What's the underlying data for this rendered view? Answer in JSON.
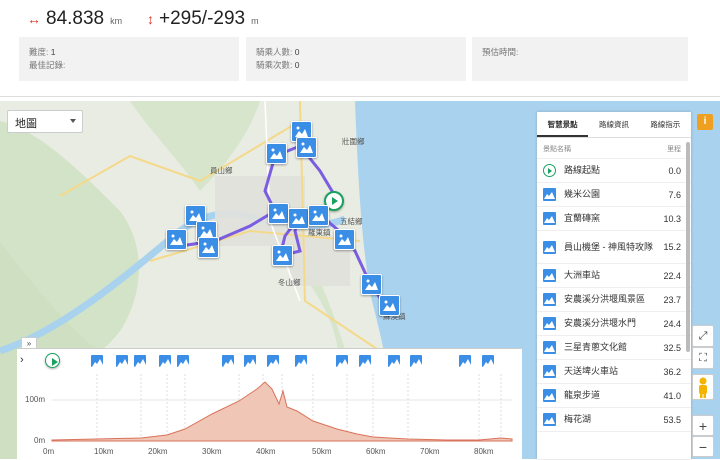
{
  "stats": {
    "distance_value": "84.838",
    "distance_unit": "km",
    "elevation_value": "+295/-293",
    "elevation_unit": "m"
  },
  "info": {
    "difficulty_label": "難度: ",
    "difficulty_value": "1",
    "best_record_label": "最佳記錄:",
    "riders_label": "騎乘人數: ",
    "riders_value": "0",
    "rides_label": "騎乘次數: ",
    "rides_value": "0",
    "eta_label": "預估時間:"
  },
  "map": {
    "layer_select": "地圖",
    "labels": [
      "壯圍鄉",
      "員山鄉",
      "五結鄉",
      "冬山鄉",
      "羅東鎮",
      "蘇澳鎮"
    ],
    "colors": {
      "route": "#7a5de0",
      "sea": "#a9d2ee",
      "land": "#e9ece2",
      "river": "#a9d2ee",
      "marker": "#3a8ee6",
      "start": "#19a15f"
    }
  },
  "elevation": {
    "toggle_label": "»",
    "expand_label": "›",
    "y_labels": [
      "100m",
      "0m"
    ],
    "x_labels": [
      "0m",
      "10km",
      "20km",
      "30km",
      "40km",
      "50km",
      "60km",
      "70km",
      "80km"
    ]
  },
  "side": {
    "tabs": [
      "智慧景點",
      "路線資訊",
      "路線指示"
    ],
    "col_name": "景點名稱",
    "col_km": "里程",
    "rows": [
      {
        "icon": "start-icon",
        "name": "路線起點",
        "km": "0.0"
      },
      {
        "icon": "photo-icon",
        "name": "幾米公園",
        "km": "7.6"
      },
      {
        "icon": "photo-icon",
        "name": "宜蘭磚窯",
        "km": "10.3"
      },
      {
        "icon": "photo-icon",
        "name": "員山機堡 - 神風特攻隊",
        "km": "15.2"
      },
      {
        "icon": "photo-icon",
        "name": "大洲車站",
        "km": "22.4"
      },
      {
        "icon": "photo-icon",
        "name": "安農溪分洪堰風景區",
        "km": "23.7"
      },
      {
        "icon": "photo-icon",
        "name": "安農溪分洪堰水門",
        "km": "24.4"
      },
      {
        "icon": "photo-icon",
        "name": "三星青蔥文化館",
        "km": "32.5"
      },
      {
        "icon": "photo-icon",
        "name": "天送埤火車站",
        "km": "36.2"
      },
      {
        "icon": "photo-icon",
        "name": "龍泉步道",
        "km": "41.0"
      },
      {
        "icon": "photo-icon",
        "name": "梅花湖",
        "km": "53.5"
      }
    ]
  },
  "controls": {
    "info": "i",
    "zoom_in": "+",
    "zoom_out": "−",
    "fullscreen": "⛶",
    "fit": "⤢"
  }
}
